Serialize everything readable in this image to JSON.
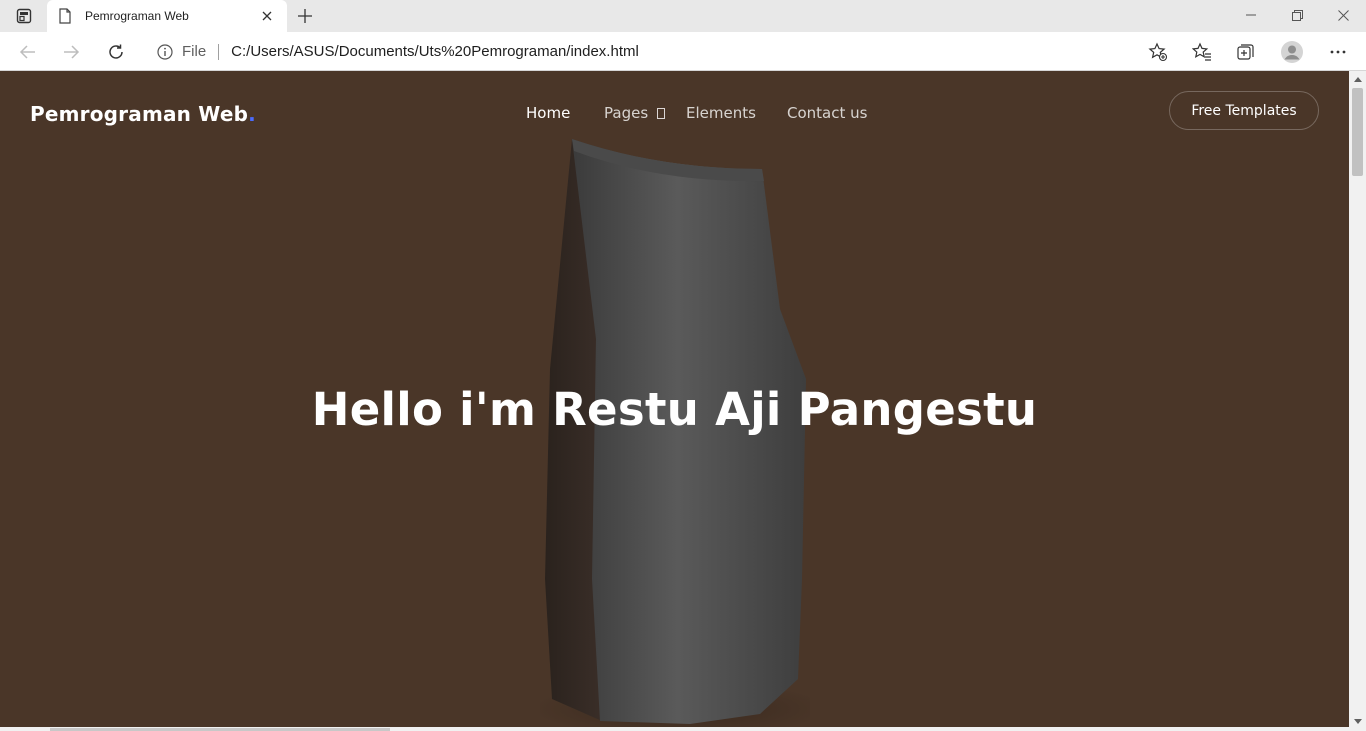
{
  "browser": {
    "tab": {
      "title": "Pemrograman Web"
    },
    "address": {
      "scheme": "File",
      "url": "C:/Users/ASUS/Documents/Uts%20Pemrograman/index.html"
    }
  },
  "page": {
    "brand": {
      "name": "Pemrograman Web",
      "dot": "."
    },
    "nav": {
      "home": "Home",
      "pages": "Pages",
      "elements": "Elements",
      "contact": "Contact us"
    },
    "cta_label": "Free Templates",
    "hero_title": "Hello i'm Restu Aji Pangestu"
  },
  "colors": {
    "hero_background": "#4a3628",
    "brand_dot": "#4b6bff",
    "text": "#ffffff"
  },
  "icons": [
    "tab-actions-icon",
    "page-file-icon",
    "close-icon",
    "plus-icon",
    "minimize-icon",
    "restore-icon",
    "back-arrow-icon",
    "forward-arrow-icon",
    "refresh-icon",
    "info-icon",
    "add-favorite-icon",
    "favorites-icon",
    "collections-icon",
    "profile-icon",
    "more-icon",
    "caret-icon",
    "scroll-up-icon",
    "scroll-down-icon"
  ]
}
